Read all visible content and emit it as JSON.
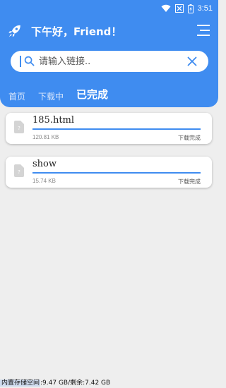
{
  "status_bar": {
    "time": "3:51",
    "icons": [
      "wifi-icon",
      "signal-icon",
      "battery-icon"
    ]
  },
  "header": {
    "logo_icon": "rocket-icon",
    "greeting": "下午好，Friend！",
    "menu_icon": "menu-icon"
  },
  "search": {
    "placeholder": "请输入链接..",
    "value": "",
    "search_icon": "search-icon",
    "clear_icon": "close-icon"
  },
  "tabs": [
    {
      "label": "首页",
      "active": false
    },
    {
      "label": "下载中",
      "active": false
    },
    {
      "label": "已完成",
      "active": true
    }
  ],
  "downloads": [
    {
      "name": "185.html",
      "size": "120.81 KB",
      "status": "下载完成",
      "progress": 1.0
    },
    {
      "name": "show",
      "size": "15.74 KB",
      "status": "下载完成",
      "progress": 1.0
    }
  ],
  "storage": {
    "label": "内置存储空间",
    "text": ":9.47 GB/剩余:7.42 GB"
  },
  "colors": {
    "accent": "#3f8cf0",
    "background": "#eeeeee",
    "card": "#ffffff"
  }
}
